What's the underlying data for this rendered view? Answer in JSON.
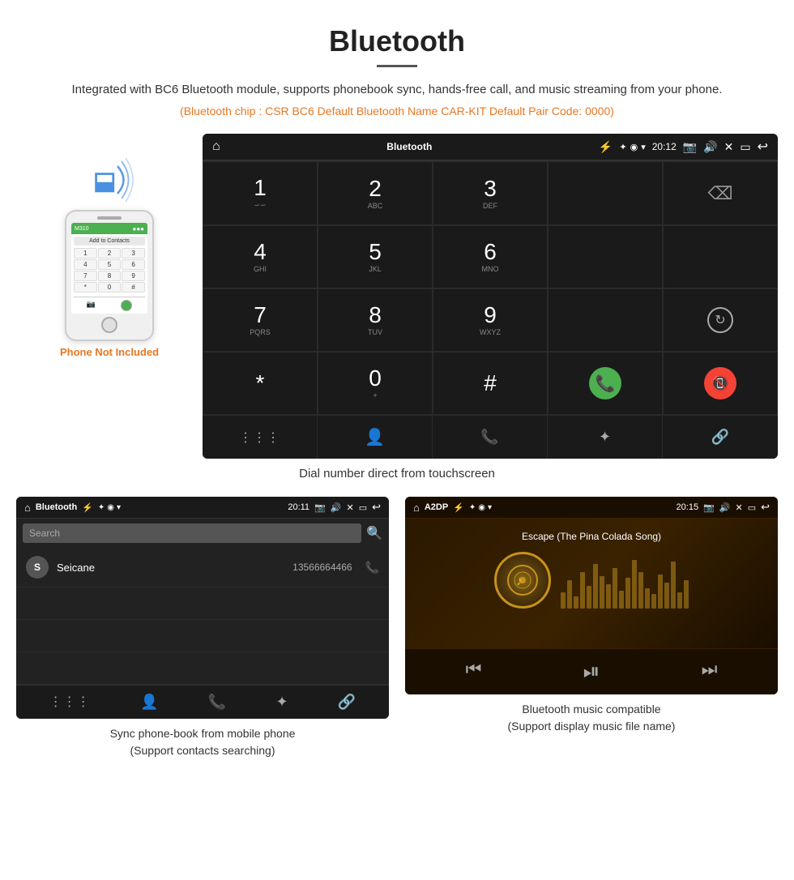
{
  "header": {
    "title": "Bluetooth",
    "description": "Integrated with BC6 Bluetooth module, supports phonebook sync, hands-free call, and music streaming from your phone.",
    "specs": "(Bluetooth chip : CSR BC6    Default Bluetooth Name CAR-KIT    Default Pair Code: 0000)"
  },
  "phone_label": "Phone Not Included",
  "dialpad": {
    "status_title": "Bluetooth",
    "time": "20:12",
    "keys": [
      {
        "num": "1",
        "sub": "∽∽"
      },
      {
        "num": "2",
        "sub": "ABC"
      },
      {
        "num": "3",
        "sub": "DEF"
      },
      {
        "num": "",
        "sub": ""
      },
      {
        "num": "⌫",
        "sub": ""
      },
      {
        "num": "4",
        "sub": "GHI"
      },
      {
        "num": "5",
        "sub": "JKL"
      },
      {
        "num": "6",
        "sub": "MNO"
      },
      {
        "num": "",
        "sub": ""
      },
      {
        "num": "",
        "sub": ""
      },
      {
        "num": "7",
        "sub": "PQRS"
      },
      {
        "num": "8",
        "sub": "TUV"
      },
      {
        "num": "9",
        "sub": "WXYZ"
      },
      {
        "num": "",
        "sub": ""
      },
      {
        "num": "↻",
        "sub": ""
      },
      {
        "num": "*",
        "sub": ""
      },
      {
        "num": "0",
        "sub": "+"
      },
      {
        "num": "#",
        "sub": ""
      },
      {
        "num": "📞",
        "sub": ""
      },
      {
        "num": "📵",
        "sub": ""
      }
    ],
    "nav_icons": [
      "⋮⋮⋮",
      "👤",
      "📞",
      "✦",
      "🔗"
    ],
    "caption": "Dial number direct from touchscreen"
  },
  "phonebook": {
    "status_title": "Bluetooth",
    "time": "20:11",
    "search_placeholder": "Search",
    "contacts": [
      {
        "initial": "S",
        "name": "Seicane",
        "number": "13566664466"
      }
    ],
    "caption_line1": "Sync phone-book from mobile phone",
    "caption_line2": "(Support contacts searching)"
  },
  "music": {
    "status_title": "A2DP",
    "time": "20:15",
    "song_title": "Escape (The Pina Colada Song)",
    "caption_line1": "Bluetooth music compatible",
    "caption_line2": "(Support display music file name)"
  }
}
